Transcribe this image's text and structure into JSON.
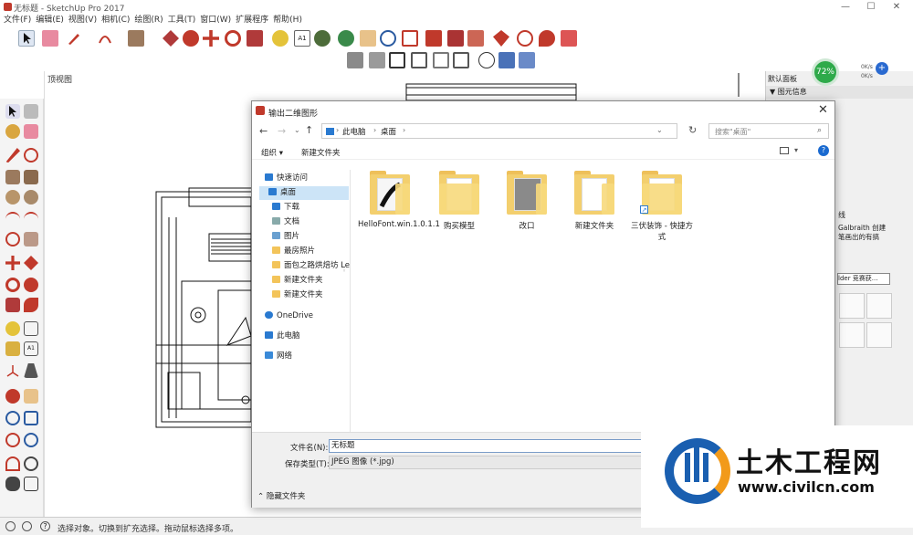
{
  "window": {
    "title": "无标题 - SketchUp Pro 2017",
    "minimize": "—",
    "maximize": "☐",
    "close": "✕"
  },
  "menu": [
    "文件(F)",
    "编辑(E)",
    "视图(V)",
    "相机(C)",
    "绘图(R)",
    "工具(T)",
    "窗口(W)",
    "扩展程序",
    "帮助(H)"
  ],
  "viewport": {
    "label": "顶视图"
  },
  "right_panel": {
    "header": "默认面板",
    "entity_info": "▼ 图元信息",
    "text1": "线",
    "text2": "Galbraith 创建",
    "text3": "笔画出的有搞",
    "dropdown": "lder 竞赛获...",
    "percent": "72%",
    "speed_up": "0K/s",
    "speed_down": "0K/s"
  },
  "status": {
    "text": "选择对象。切换到扩充选择。拖动鼠标选择多项。"
  },
  "dialog": {
    "title": "输出二维图形",
    "close": "✕",
    "path": [
      "此电脑",
      "桌面"
    ],
    "search_placeholder": "搜索\"桌面\"",
    "organize": "组织 ▾",
    "new_folder": "新建文件夹",
    "nav": [
      "快速访问",
      "桌面",
      "下载",
      "文档",
      "图片",
      "最房照片",
      "面包之路烘焙坊 Le",
      "新建文件夹",
      "新建文件夹",
      "OneDrive",
      "此电脑",
      "网络"
    ],
    "files": [
      "HelloFont.win.1.0.1.1",
      "购买模型",
      "改口",
      "新建文件夹",
      "三伏装饰 - 快捷方式"
    ],
    "filename_label": "文件名(N):",
    "filename_value": "无标题",
    "filetype_label": "保存类型(T):",
    "filetype_value": "JPEG 图像 (*.jpg)",
    "hide_folders": "隐藏文件夹"
  },
  "watermark": {
    "brand": "土木工程网",
    "url": "www.civilcn.com"
  }
}
